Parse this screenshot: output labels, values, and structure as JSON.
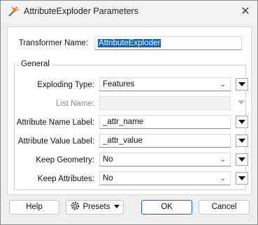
{
  "window": {
    "title": "AttributeExploder Parameters"
  },
  "transformer_name": {
    "label": "Transformer Name:",
    "value": "AttributeExploder"
  },
  "group": {
    "label": "General",
    "exploding_type": {
      "label": "Exploding Type:",
      "value": "Features"
    },
    "list_name": {
      "label": "List Name:",
      "value": ""
    },
    "attr_name_label": {
      "label": "Attribute Name Label:",
      "value": "_attr_name"
    },
    "attr_value_label": {
      "label": "Attribute Value Label:",
      "value": "_attr_value"
    },
    "keep_geometry": {
      "label": "Keep Geometry:",
      "value": "No"
    },
    "keep_attributes": {
      "label": "Keep Attributes:",
      "value": "No"
    }
  },
  "buttons": {
    "help": "Help",
    "presets": "Presets",
    "ok": "OK",
    "cancel": "Cancel"
  },
  "colors": {
    "selection": "#0a64c8",
    "ok_border": "#1a64b5"
  }
}
